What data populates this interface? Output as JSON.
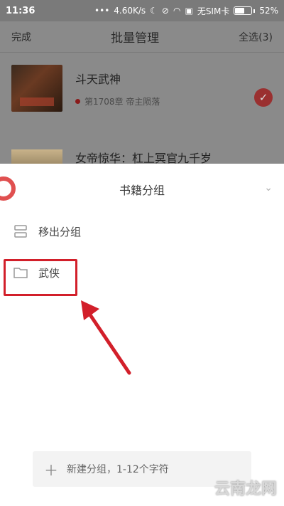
{
  "status_bar": {
    "time": "11:36",
    "network_speed": "4.60K/s",
    "sim": "无SIM卡",
    "battery": "52%",
    "battery_level": 0.52
  },
  "header": {
    "done": "完成",
    "title": "批量管理",
    "select_all": "全选(3)"
  },
  "books": [
    {
      "title": "斗天武神",
      "chapter": "第1708章 帝主陨落",
      "selected": true
    },
    {
      "title": "女帝惊华：杠上冥官九千岁"
    }
  ],
  "sheet": {
    "title": "书籍分组",
    "items": [
      {
        "label": "移出分组",
        "icon": "move-out-icon"
      },
      {
        "label": "武侠",
        "icon": "folder-icon"
      }
    ],
    "new_group_placeholder": "新建分组，1-12个字符"
  },
  "watermark": "云南龙网",
  "colors": {
    "highlight": "#d21f2a",
    "accent": "#e05050"
  }
}
